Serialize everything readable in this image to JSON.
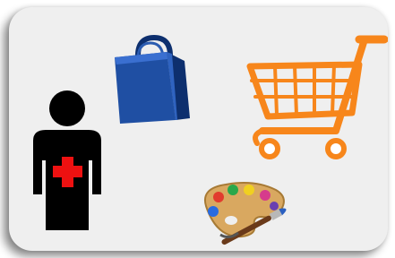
{
  "icons": [
    {
      "name": "person-first-aid-icon",
      "colors": {
        "body": "#000000",
        "cross": "#ee1111"
      }
    },
    {
      "name": "shopping-bag-icon",
      "colors": {
        "front": "#1f4fa3",
        "side": "#0d2f6e"
      }
    },
    {
      "name": "shopping-cart-icon",
      "colors": {
        "stroke": "#f7861b"
      }
    },
    {
      "name": "paint-palette-icon",
      "colors": {
        "board": "#d9a860"
      }
    }
  ],
  "colors": {
    "card_background": "#efefef"
  }
}
